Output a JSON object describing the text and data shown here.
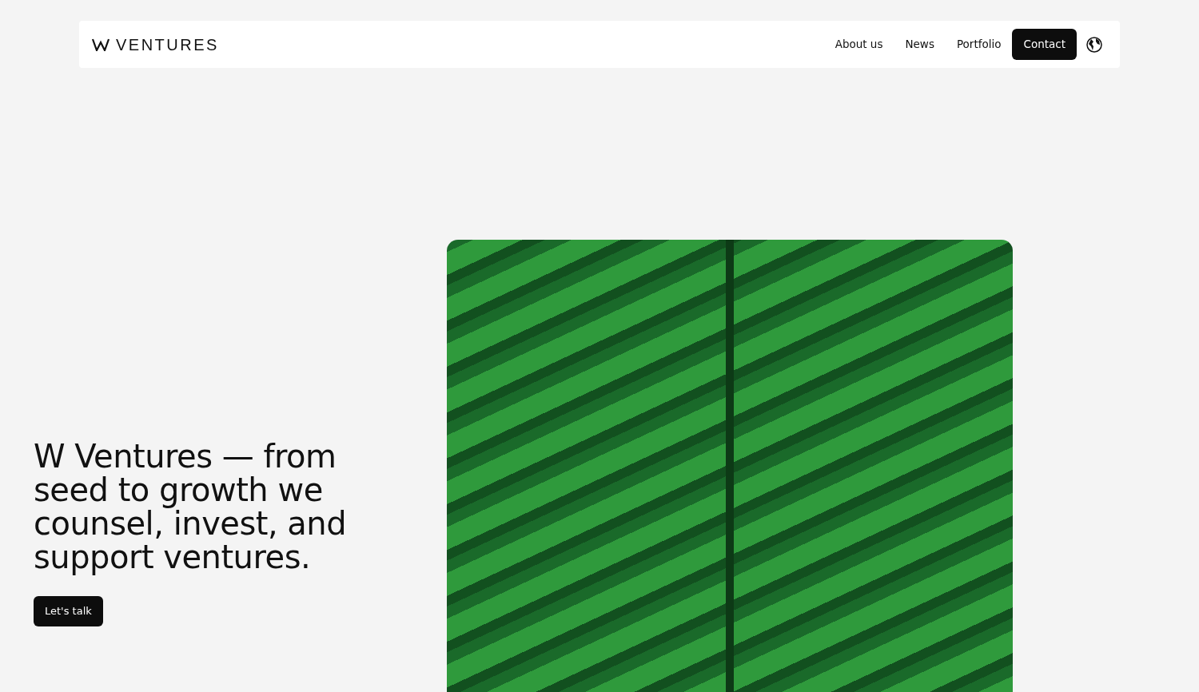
{
  "header": {
    "logo_text": "VENTURES",
    "nav": [
      {
        "label": "About us",
        "kind": "link"
      },
      {
        "label": "News",
        "kind": "link"
      },
      {
        "label": "Portfolio",
        "kind": "link"
      },
      {
        "label": "Contact",
        "kind": "button"
      }
    ]
  },
  "hero": {
    "headline": "W Ventures — from seed to growth we counsel, invest, and support ventures.",
    "cta": "Let's talk"
  }
}
